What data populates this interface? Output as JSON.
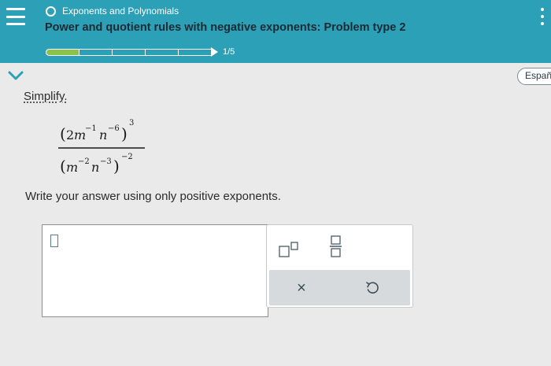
{
  "header": {
    "topic": "Exponents and Polynomials",
    "problem_title": "Power and quotient rules with negative exponents: Problem type 2",
    "progress": {
      "current": 1,
      "total": 5,
      "label": "1/5"
    }
  },
  "language_button": "Españ",
  "prompt": "Simplify.",
  "expression": {
    "numerator": {
      "coefficient": "2",
      "var1": "m",
      "exp1": "−1",
      "var2": "n",
      "exp2": "−6",
      "outer_exp": "3"
    },
    "denominator": {
      "var1": "m",
      "exp1": "−2",
      "var2": "n",
      "exp2": "−3",
      "outer_exp": "−2"
    }
  },
  "instructions": "Write your answer using only positive exponents.",
  "tools": {
    "superscript": "superscript-icon",
    "fraction": "fraction-icon",
    "clear": "×",
    "undo": "undo-icon"
  },
  "colors": {
    "header_bg": "#2ba0b6",
    "progress_fill": "#8bc34a",
    "page_bg": "#eaeaea",
    "action_bar": "#d6dadc"
  }
}
